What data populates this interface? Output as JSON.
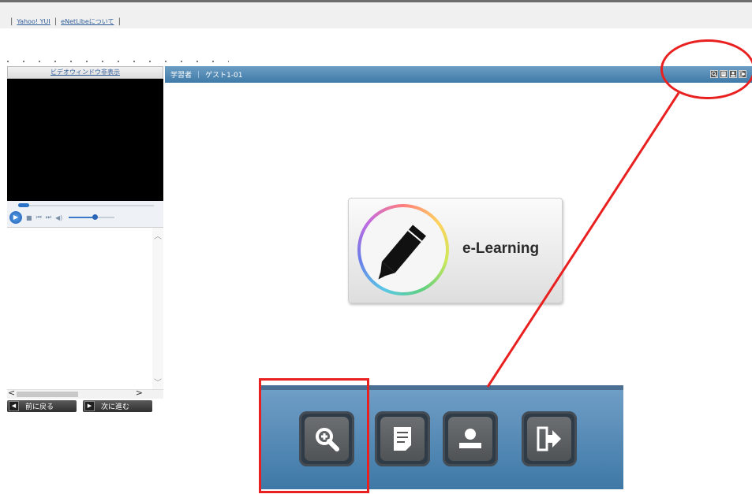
{
  "top_links": {
    "link1": "Yahoo! YUI",
    "link2": "eNetLibeについて"
  },
  "left_panel": {
    "video_toggle": "ビデオウィンドウ非表示",
    "prev_button": "前に戻る",
    "next_button": "次に進む"
  },
  "header": {
    "role": "学習者",
    "user": "ゲスト1-01"
  },
  "logo": {
    "text": "e-Learning"
  },
  "toolbar_icons": [
    "zoom-icon",
    "document-icon",
    "user-icon",
    "logout-icon"
  ],
  "colors": {
    "header": "#4a83b0",
    "annotation": "#e8201f"
  }
}
